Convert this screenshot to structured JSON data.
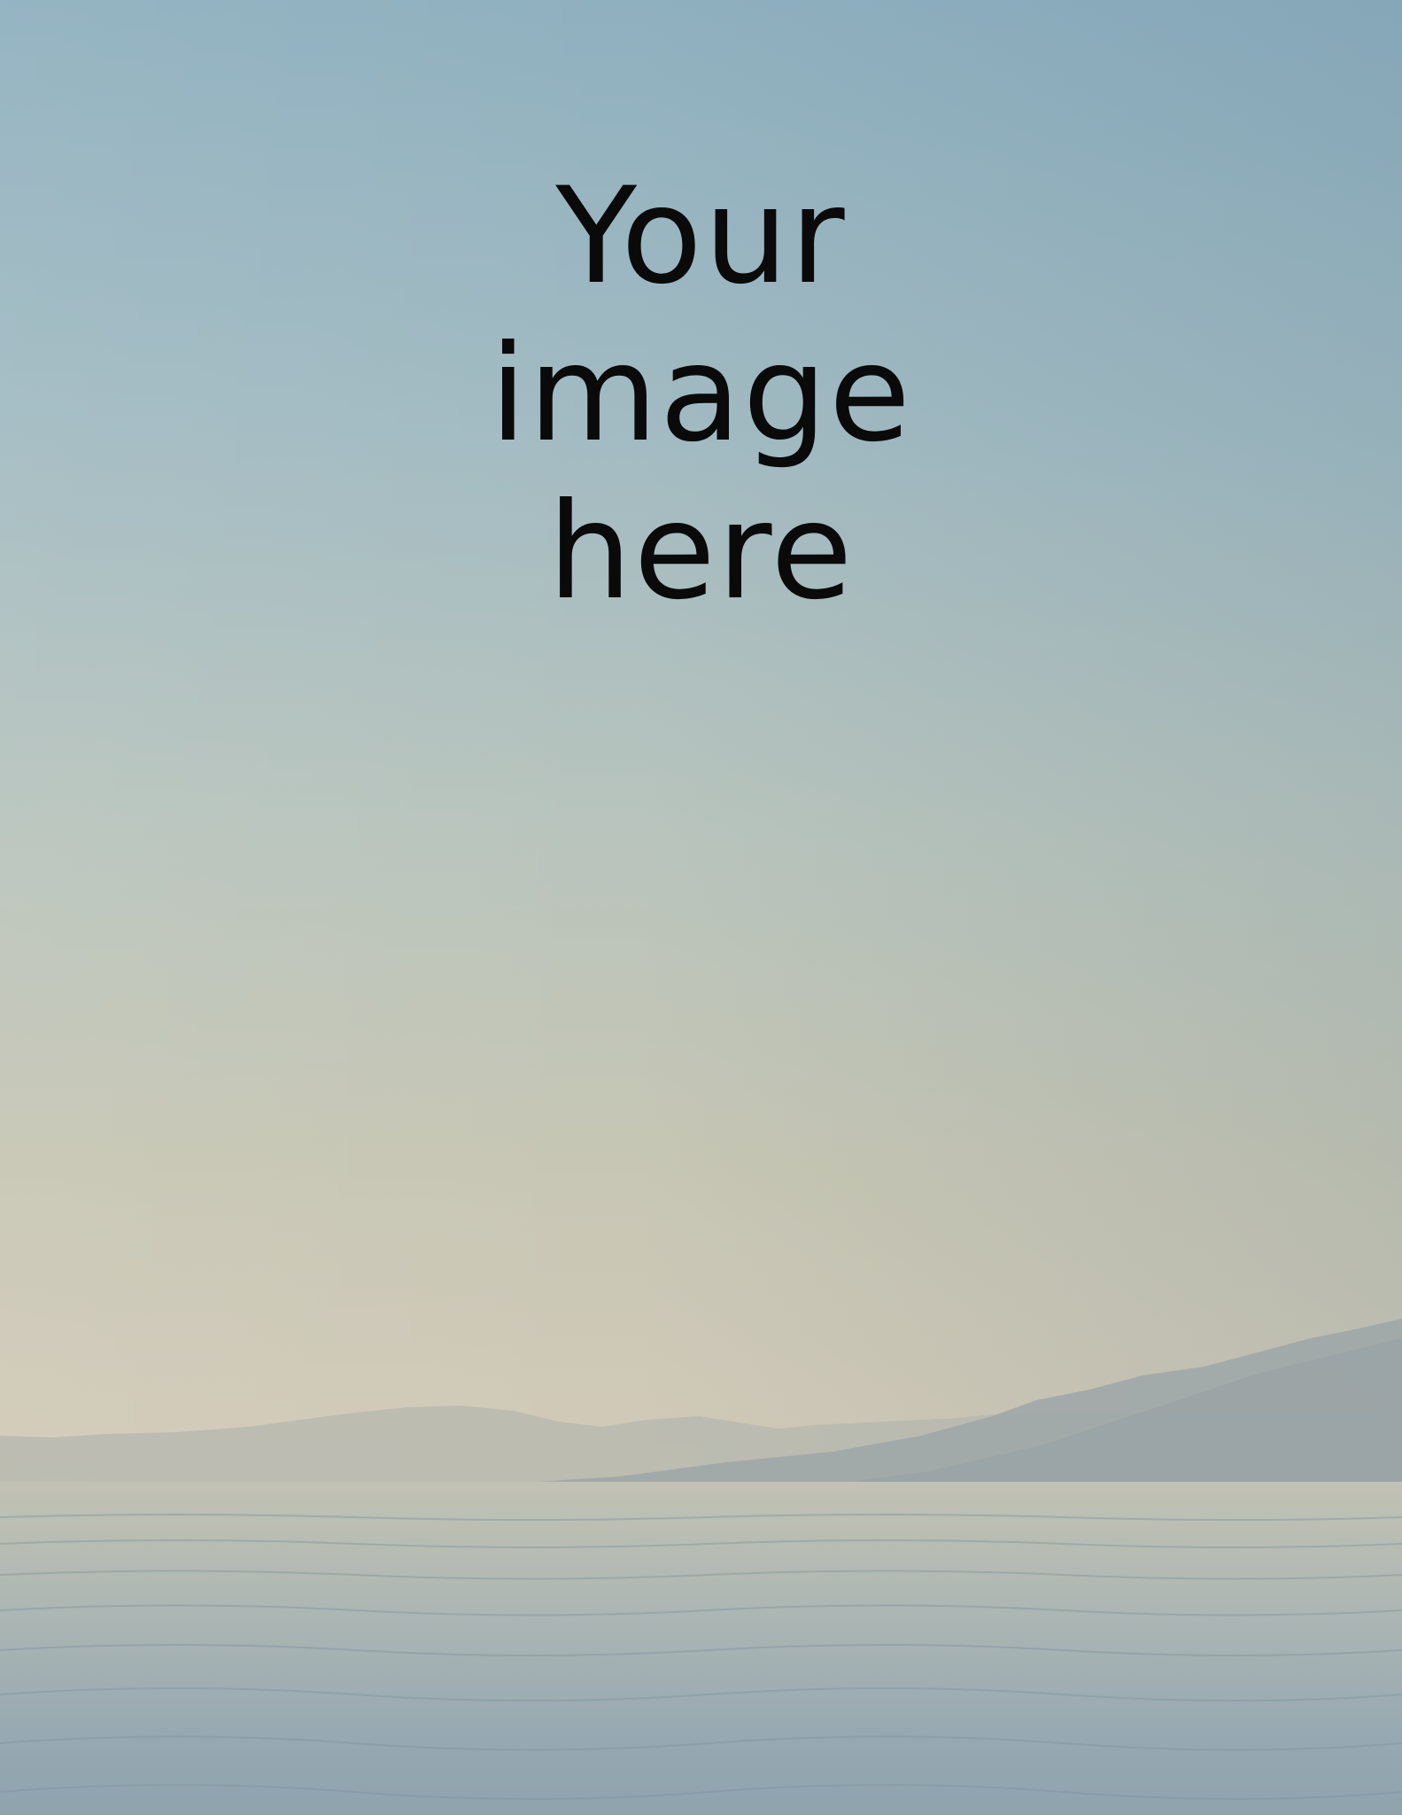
{
  "placeholder": {
    "lines": [
      "Your",
      "image",
      "here"
    ]
  },
  "scene": {
    "description_icon": "seascape-photo",
    "colors": {
      "sky_top": "#8fb0bf",
      "sky_horizon": "#d3cab8",
      "mountain": "#9aa3a6",
      "sea": "#97a9b2",
      "text": "#0a0a0a"
    }
  }
}
